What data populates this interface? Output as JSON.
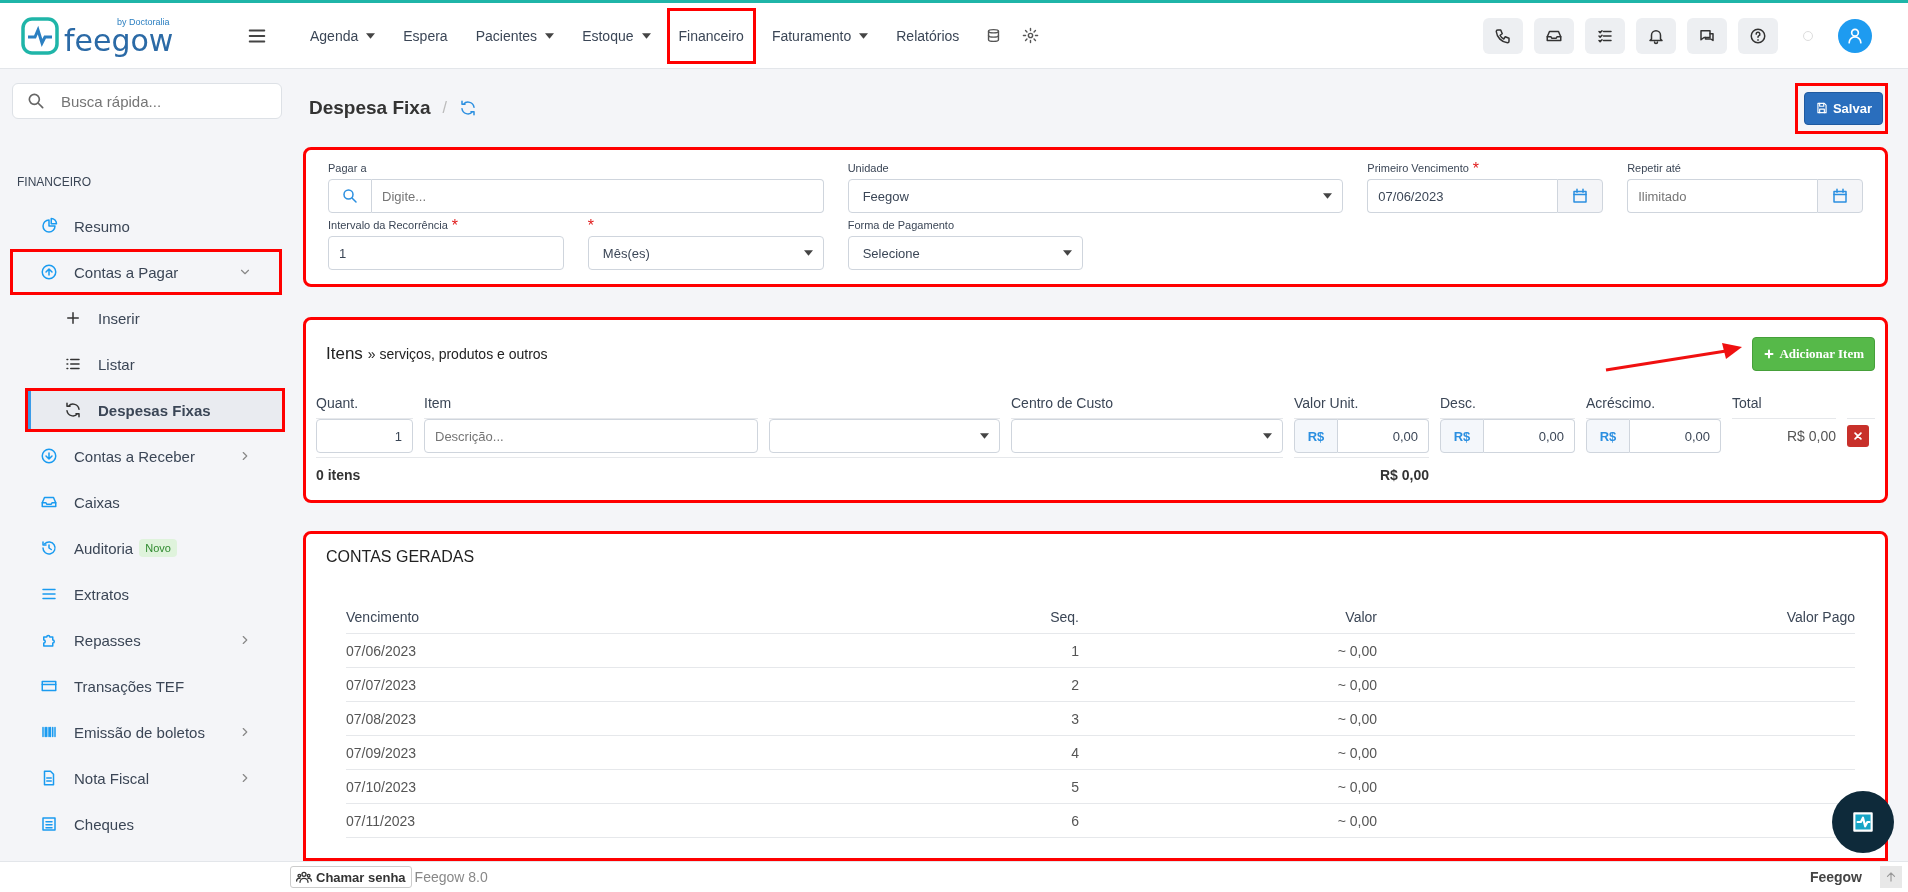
{
  "topbar": {
    "logo": {
      "brand": "feegow",
      "tagline": "by Doctoralia"
    },
    "nav": [
      {
        "label": "Agenda",
        "kind": "menu",
        "highlighted": false
      },
      {
        "label": "Espera",
        "kind": "link",
        "highlighted": false
      },
      {
        "label": "Pacientes",
        "kind": "menu",
        "highlighted": false
      },
      {
        "label": "Estoque",
        "kind": "menu",
        "highlighted": false
      },
      {
        "label": "Financeiro",
        "kind": "link",
        "highlighted": true
      },
      {
        "label": "Faturamento",
        "kind": "menu",
        "highlighted": false
      },
      {
        "label": "Relatórios",
        "kind": "link",
        "highlighted": false
      }
    ]
  },
  "sidebar": {
    "search": {
      "placeholder": "Busca rápida..."
    },
    "section": "FINANCEIRO",
    "items": [
      {
        "label": "Resumo",
        "highlighted": false
      },
      {
        "label": "Contas a Pagar",
        "expanded": true,
        "highlighted": true,
        "children": [
          {
            "label": "Inserir",
            "selected": false,
            "highlighted": false
          },
          {
            "label": "Listar",
            "selected": false,
            "highlighted": false
          },
          {
            "label": "Despesas Fixas",
            "selected": true,
            "highlighted": true
          }
        ]
      },
      {
        "label": "Contas a Receber",
        "expanded": false,
        "highlighted": false
      },
      {
        "label": "Caixas",
        "highlighted": false
      },
      {
        "label": "Auditoria",
        "badge": "Novo",
        "highlighted": false
      },
      {
        "label": "Extratos",
        "highlighted": false
      },
      {
        "label": "Repasses",
        "expanded": false,
        "highlighted": false
      },
      {
        "label": "Transações TEF",
        "highlighted": false
      },
      {
        "label": "Emissão de boletos",
        "expanded": false,
        "highlighted": false
      },
      {
        "label": "Nota Fiscal",
        "expanded": false,
        "highlighted": false
      },
      {
        "label": "Cheques",
        "highlighted": false
      }
    ]
  },
  "page": {
    "title": "Despesa Fixa",
    "separator": "/",
    "save_button": {
      "label": "Salvar",
      "highlighted": true
    }
  },
  "form": {
    "highlighted": true,
    "required_mark": "*",
    "fields": [
      {
        "label": "Pagar a",
        "kind": "search",
        "placeholder": "Digite...",
        "required": false
      },
      {
        "label": "Unidade",
        "kind": "select",
        "value": "Feegow",
        "required": false
      },
      {
        "label": "Primeiro Vencimento",
        "kind": "date",
        "value": "07/06/2023",
        "required": true
      },
      {
        "label": "Repetir até",
        "kind": "date",
        "placeholder": "Ilimitado",
        "required": false
      },
      {
        "label": "Intervalo da Recorrência",
        "kind": "text",
        "value": "1",
        "required": true
      },
      {
        "kind": "select",
        "value": "Mês(es)",
        "required": true
      },
      {
        "label": "Forma de Pagamento",
        "kind": "select",
        "value": "Selecione",
        "required": false
      }
    ]
  },
  "items": {
    "highlighted": true,
    "title": "Itens",
    "subtitle": "» serviços, produtos e outros",
    "add_button": "Adicionar Item",
    "annotation_arrow": true,
    "columns": [
      "Quant.",
      "Item",
      "",
      "Centro de Custo",
      "Valor Unit.",
      "Desc.",
      "Acréscimo.",
      "Total"
    ],
    "row": {
      "cells": [
        {
          "kind": "number",
          "value": "1"
        },
        {
          "kind": "text",
          "placeholder": "Descrição..."
        },
        {
          "kind": "select"
        },
        {
          "kind": "select"
        },
        {
          "kind": "money",
          "prefix": "R$",
          "value": "0,00"
        },
        {
          "kind": "money",
          "prefix": "R$",
          "value": "0,00"
        },
        {
          "kind": "money",
          "prefix": "R$",
          "value": "0,00"
        }
      ],
      "total": "R$ 0,00"
    },
    "count": "0 itens",
    "sum": "R$ 0,00"
  },
  "generated": {
    "highlighted": true,
    "title": "CONTAS GERADAS",
    "columns": [
      "Vencimento",
      "Seq.",
      "Valor",
      "Valor Pago"
    ],
    "rows": [
      [
        "07/06/2023",
        "1",
        "~ 0,00",
        ""
      ],
      [
        "07/07/2023",
        "2",
        "~ 0,00",
        ""
      ],
      [
        "07/08/2023",
        "3",
        "~ 0,00",
        ""
      ],
      [
        "07/09/2023",
        "4",
        "~ 0,00",
        ""
      ],
      [
        "07/10/2023",
        "5",
        "~ 0,00",
        ""
      ],
      [
        "07/11/2023",
        "6",
        "~ 0,00",
        ""
      ]
    ]
  },
  "footer": {
    "call_button": "Chamar senha",
    "version": "Feegow 8.0",
    "brand": "Feegow"
  }
}
